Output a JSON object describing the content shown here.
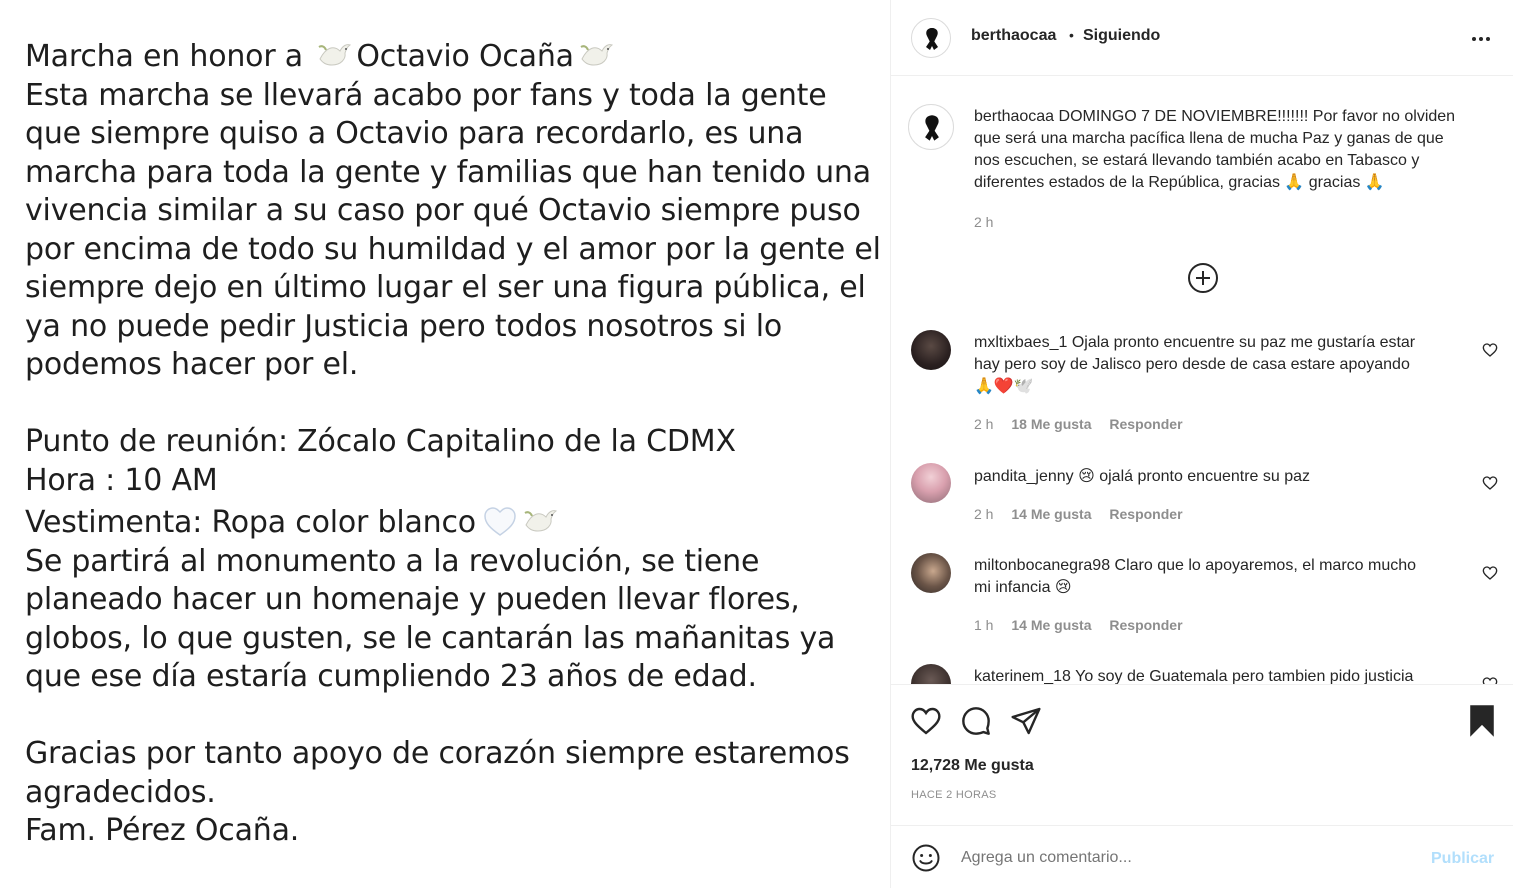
{
  "image_text": {
    "title_pre": "Marcha en honor a ",
    "title_name": "Octavio Ocaña",
    "para1": [
      "Esta marcha se llevará acabo por fans y toda la gente",
      "que siempre quiso a Octavio para recordarlo, es una",
      "marcha para toda la gente y familias que han tenido una",
      "vivencia similar a su caso por qué Octavio siempre puso",
      "por encima de todo su humildad y el amor por la gente el",
      "siempre dejo en último lugar el ser una figura pública, el",
      "ya no puede pedir Justicia pero todos nosotros si lo",
      "podemos hacer por el."
    ],
    "meeting": "Punto de reunión: Zócalo Capitalino de la CDMX",
    "hour": "Hora : 10 AM",
    "dress": "Vestimenta: Ropa color blanco",
    "para2": [
      "Se partirá al monumento a la revolución, se tiene",
      "planeado hacer un homenaje y pueden llevar flores,",
      "globos, lo que gusten, se le cantarán las mañanitas ya",
      "que ese día estaría cumpliendo 23 años de edad."
    ],
    "thanks": [
      "Gracias por tanto apoyo de corazón siempre estaremos",
      "agradecidos.",
      "Fam. Pérez Ocaña."
    ]
  },
  "header": {
    "username": "berthaocaa",
    "separator": "•",
    "follow_status": "Siguiendo",
    "more_icon": "more-horizontal-icon"
  },
  "caption": {
    "username": "berthaocaa",
    "text_lines": [
      "DOMINGO 7 DE NOVIEMBRE!!!!!!! Por favor no olviden",
      "que será una marcha pacífica llena de mucha Paz y ganas de que",
      "nos escuchen, se estará llevando también acabo en Tabasco y",
      "diferentes estados de la República, gracias 🙏 gracias 🙏"
    ],
    "time": "2 h"
  },
  "load_more_icon": "plus-circle-icon",
  "comments": [
    {
      "username": "mxltixbaes_1",
      "lines": [
        "Ojala pronto encuentre su paz me gustaría estar",
        "hay pero soy de Jalisco pero desde de casa estare apoyando",
        "🙏❤️🕊️"
      ],
      "time": "2 h",
      "likes": "18 Me gusta",
      "reply": "Responder"
    },
    {
      "username": "pandita_jenny",
      "lines": [
        "😢 ojalá pronto encuentre su paz"
      ],
      "time": "2 h",
      "likes": "14 Me gusta",
      "reply": "Responder"
    },
    {
      "username": "miltonbocanegra98",
      "lines": [
        "Claro que lo apoyaremos, el marco mucho",
        "mi infancia 😢"
      ],
      "time": "1 h",
      "likes": "14 Me gusta",
      "reply": "Responder"
    },
    {
      "username": "katerinem_18",
      "lines": [
        "Yo soy de Guatemala pero tambien pido justicia"
      ],
      "time": "",
      "likes": "",
      "reply": ""
    }
  ],
  "actions": {
    "like_icon": "heart-icon",
    "comment_icon": "comment-icon",
    "share_icon": "share-icon",
    "save_icon": "bookmark-icon",
    "likes_count": "12,728 Me gusta",
    "posted_ago": "HACE 2 HORAS"
  },
  "add_comment": {
    "emoji_icon": "smiley-icon",
    "placeholder": "Agrega un comentario...",
    "post_label": "Publicar",
    "post_color": "#b2dffc"
  }
}
